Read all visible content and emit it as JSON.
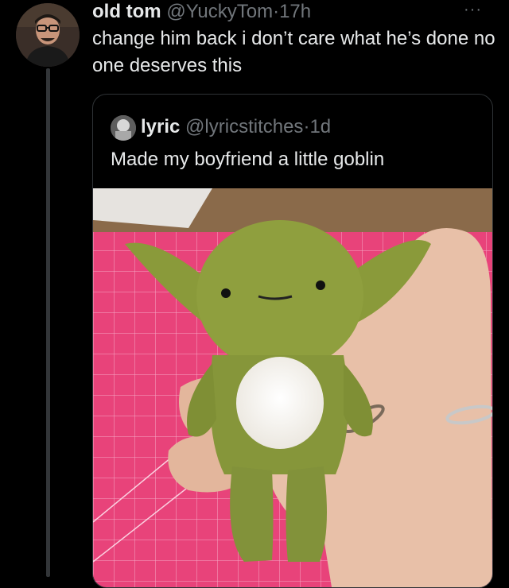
{
  "tweet": {
    "author_name": "old tom",
    "author_handle": "@YuckyTom",
    "separator": "·",
    "time": "17h",
    "more": "···",
    "text": "change him back i don’t care what he’s done no one deserves this"
  },
  "quoted_tweet": {
    "author_name": "lyric",
    "author_handle": "@lyricstitches",
    "separator": "·",
    "time": "1d",
    "text": "Made my boyfriend a little goblin"
  },
  "colors": {
    "background": "#000000",
    "primary_text": "#e7e9ea",
    "secondary_text": "#71767b",
    "border": "#2f3336",
    "cutting_mat": "#e8437a",
    "plush_green": "#8a9a3a"
  }
}
